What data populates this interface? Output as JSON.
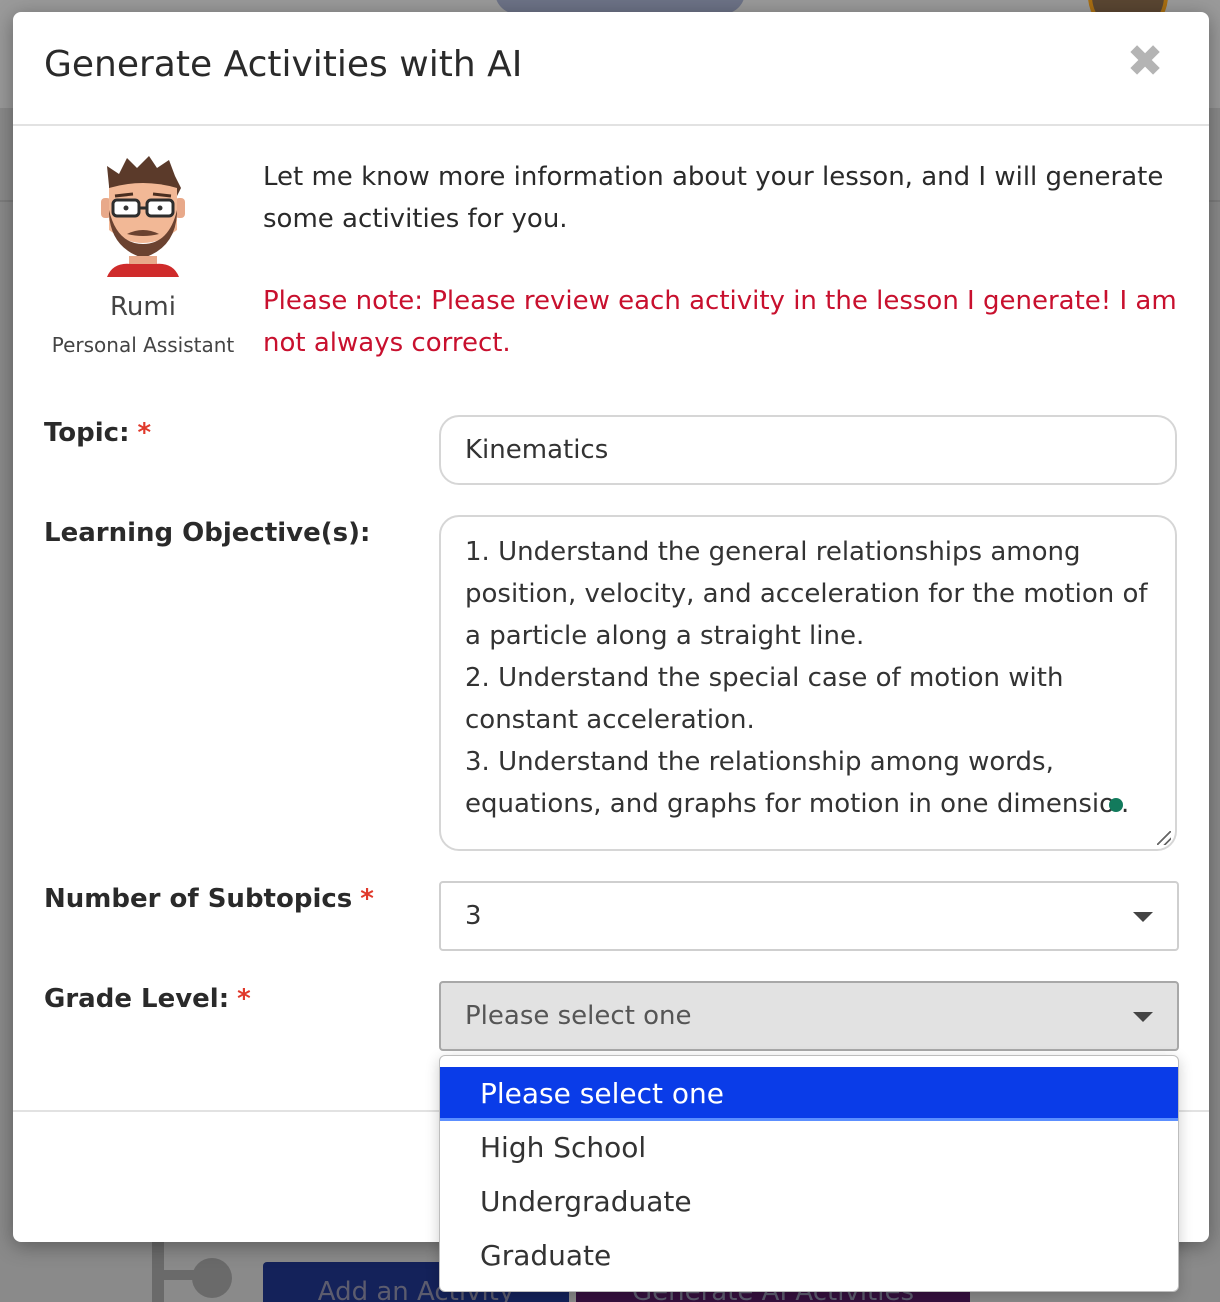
{
  "modal": {
    "title": "Generate Activities with AI",
    "close_label": "✖"
  },
  "assistant": {
    "name": "Rumi",
    "role": "Personal Assistant",
    "intro": "Let me know more information about your lesson, and I will generate some activities for you.",
    "note": "Please note: Please review each activity in the lesson I generate! I am not always correct."
  },
  "form": {
    "topic": {
      "label": "Topic:",
      "required_mark": "*",
      "value": "Kinematics"
    },
    "objectives": {
      "label": "Learning Objective(s):",
      "value_before_cursor": "1. Understand the general relationships among position, velocity, and acceleration for the motion of a particle along a straight line.\n2. Understand the special case of motion with constant acceleration.\n3. Understand the relationship among words, equations, and graphs for motion in one dimensio",
      "value_after_cursor": "."
    },
    "subtopics": {
      "label": "Number of Subtopics",
      "required_mark": "*",
      "value": "3"
    },
    "grade": {
      "label": "Grade Level:",
      "required_mark": "*",
      "value": "Please select one"
    }
  },
  "grade_options": [
    "Please select one",
    "High School",
    "Undergraduate",
    "Graduate"
  ],
  "background": {
    "add_activity": "Add an Activity",
    "generate_ai": "Generate AI Activities"
  },
  "colors": {
    "note": "#c8102e",
    "required": "#e0392b",
    "selected_option": "#0a3ce8"
  }
}
